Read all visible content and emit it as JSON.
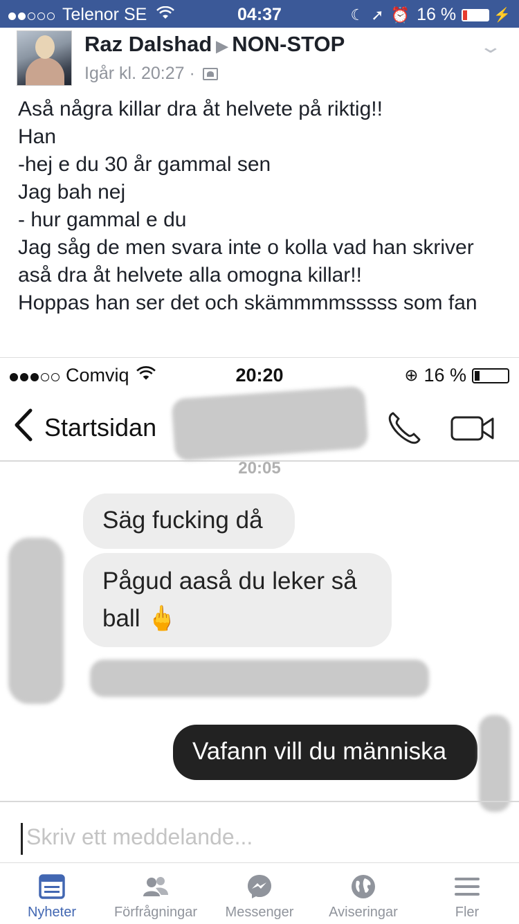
{
  "status_bar": {
    "carrier": "Telenor SE",
    "time": "04:37",
    "battery_percent": "16 %",
    "battery_level": 0.16,
    "signal_bars": 2
  },
  "post": {
    "author": "Raz Dalshad",
    "group": "NON-STOP",
    "timestamp": "Igår kl. 20:27",
    "separator": "·",
    "lines": [
      "Aså några killar dra åt helvete på riktig!!",
      "Han",
      "-hej e du 30 år gammal sen",
      "Jag bah nej",
      "- hur gammal e du",
      "Jag såg de men svara inte o kolla vad han skriver aså dra åt helvete alla omogna killar!!",
      "Hoppas han ser det och skämmmmsssss som fan"
    ]
  },
  "screenshot": {
    "status": {
      "carrier": "Comviq",
      "time": "20:20",
      "battery_percent": "16 %",
      "battery_level": 0.16
    },
    "nav": {
      "back_label": "Startsidan"
    },
    "timestamp": "20:05",
    "messages": [
      {
        "direction": "in",
        "text": "Säg fucking då"
      },
      {
        "direction": "in",
        "text": "Pågud aaså du leker så ball 🖕"
      },
      {
        "direction": "out",
        "text": "Vafann vill du människa"
      }
    ],
    "compose_placeholder": "Skriv ett meddelande..."
  },
  "tab_bar": {
    "accent": "#4267b2",
    "inactive": "#90949c",
    "items": [
      {
        "label": "Nyheter",
        "icon": "news-feed-icon",
        "active": true
      },
      {
        "label": "Förfrågningar",
        "icon": "friend-requests-icon",
        "active": false
      },
      {
        "label": "Messenger",
        "icon": "messenger-icon",
        "active": false
      },
      {
        "label": "Aviseringar",
        "icon": "globe-icon",
        "active": false
      },
      {
        "label": "Fler",
        "icon": "menu-icon",
        "active": false
      }
    ]
  }
}
